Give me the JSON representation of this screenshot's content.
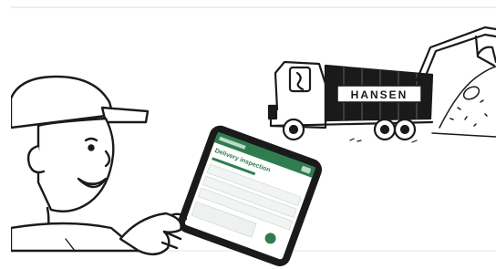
{
  "scene": {
    "truck": {
      "brand": "HANSEN"
    },
    "tablet": {
      "app_title": "Delivery inspection",
      "header_color": "#2e7d4f"
    }
  },
  "colors": {
    "ink": "#1a1a1a",
    "paper": "#ffffff",
    "tablet_green": "#2e7d4f"
  }
}
